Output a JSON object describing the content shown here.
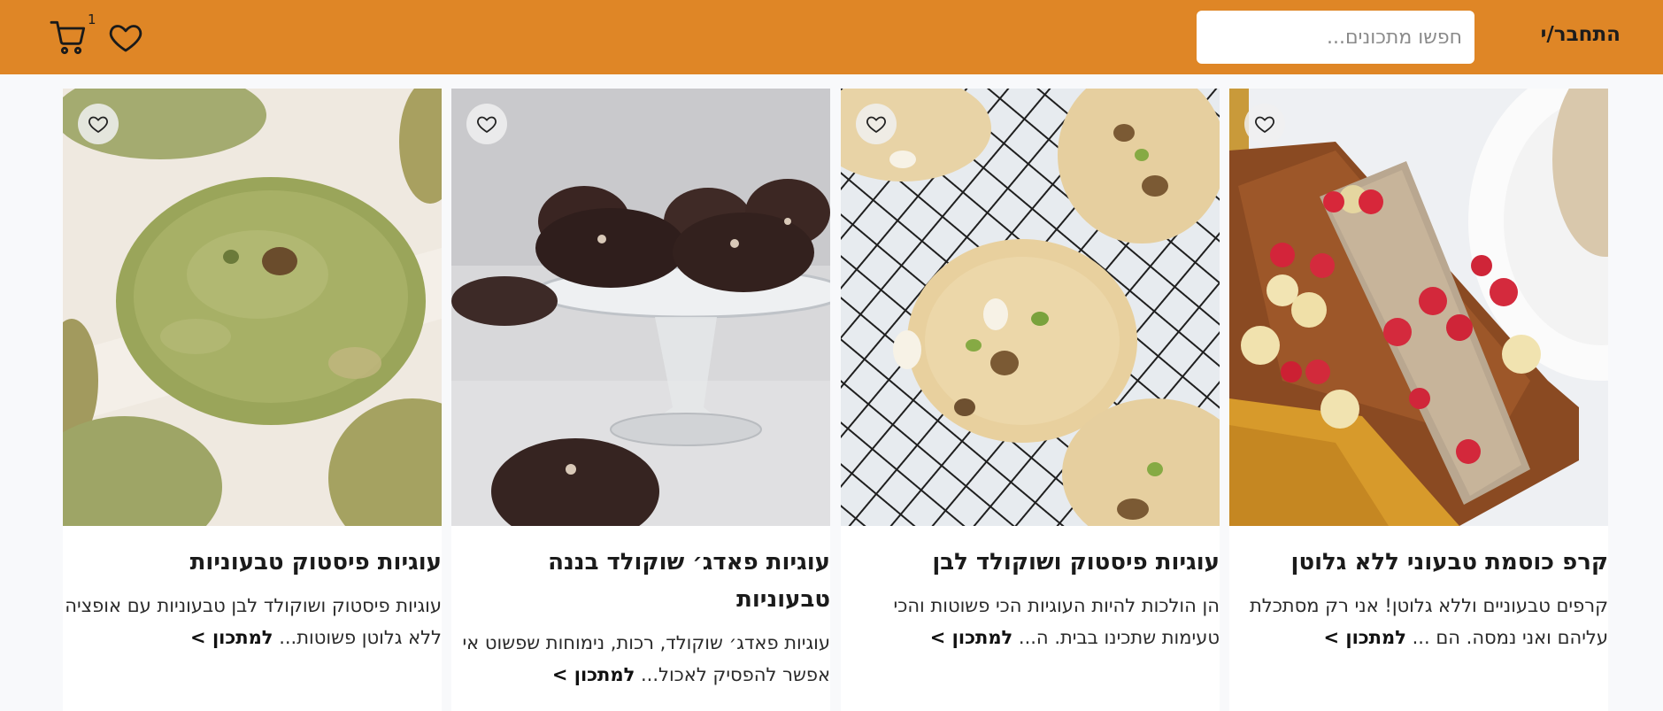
{
  "header": {
    "login_label": "התחבר/י",
    "search_placeholder": "חפשו מתכונים...",
    "cart_count": "1",
    "brand_color": "#df8626"
  },
  "cards": [
    {
      "title": "קרפ כוסמת טבעוני ללא גלוטן",
      "description": "קרפים טבעוניים וללא גלוטן! אני רק מסתכלת עליהם ואני נמסה. הם ...",
      "read_more": "למתכון >",
      "image": "strawberry-banana-crepe-photo"
    },
    {
      "title": "עוגיות פיסטוק ושוקולד לבן",
      "description": "הן הולכות להיות העוגיות הכי פשוטות והכי טעימות שתכינו בבית. ה...",
      "read_more": "למתכון >",
      "image": "pistachio-white-chocolate-cookies-photo"
    },
    {
      "title": "עוגיות פאדג׳ שוקולד בננה טבעוניות",
      "description": "עוגיות פאדג׳ שוקולד, רכות, נימוחות שפשוט אי אפשר להפסיק לאכול...",
      "read_more": "למתכון >",
      "image": "chocolate-fudge-cookies-photo"
    },
    {
      "title": "עוגיות פיסטוק טבעוניות",
      "description": "עוגיות פיסטוק ושוקולד לבן טבעוניות עם אופציה ללא גלוטן פשוטות...",
      "read_more": "למתכון >",
      "image": "pistachio-cookies-photo"
    }
  ]
}
